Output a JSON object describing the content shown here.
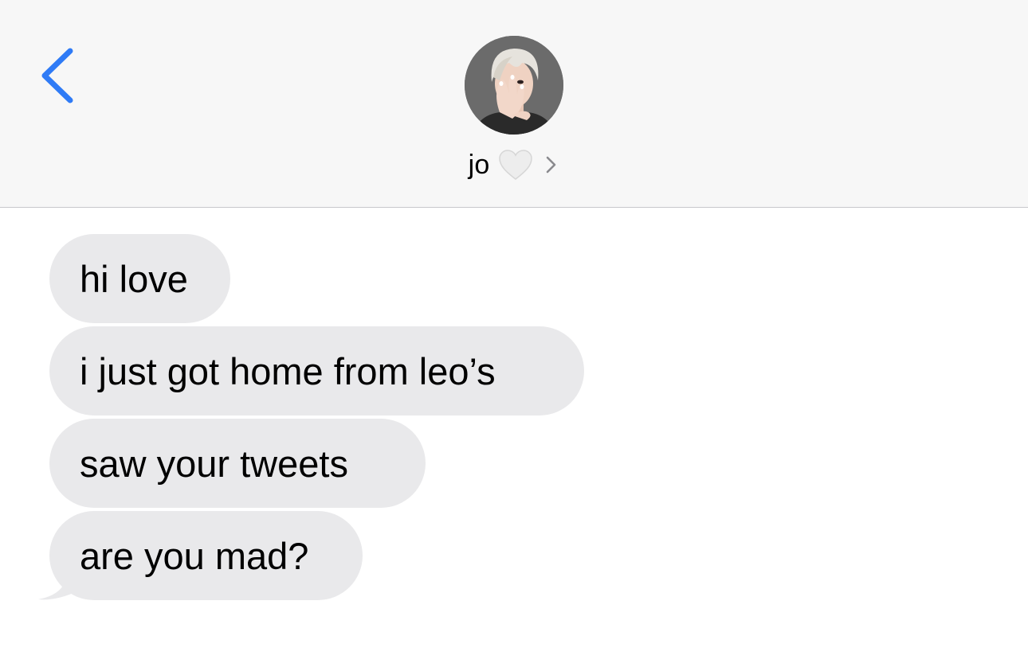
{
  "header": {
    "back_icon": "chevron-left-icon",
    "contact_name": "jo",
    "name_emoji_icon": "white-heart-icon",
    "details_icon": "chevron-right-icon",
    "avatar": "contact-avatar-photo"
  },
  "messages": [
    {
      "direction": "incoming",
      "text": "hi love"
    },
    {
      "direction": "incoming",
      "text": "i just got home from leo’s"
    },
    {
      "direction": "incoming",
      "text": "saw your tweets"
    },
    {
      "direction": "incoming",
      "text": "are you mad?"
    }
  ],
  "colors": {
    "accent": "#2f7bf6",
    "header_bg": "#f7f7f7",
    "incoming_bubble": "#e9e9eb",
    "divider": "#c8c8cc",
    "text": "#000000"
  }
}
